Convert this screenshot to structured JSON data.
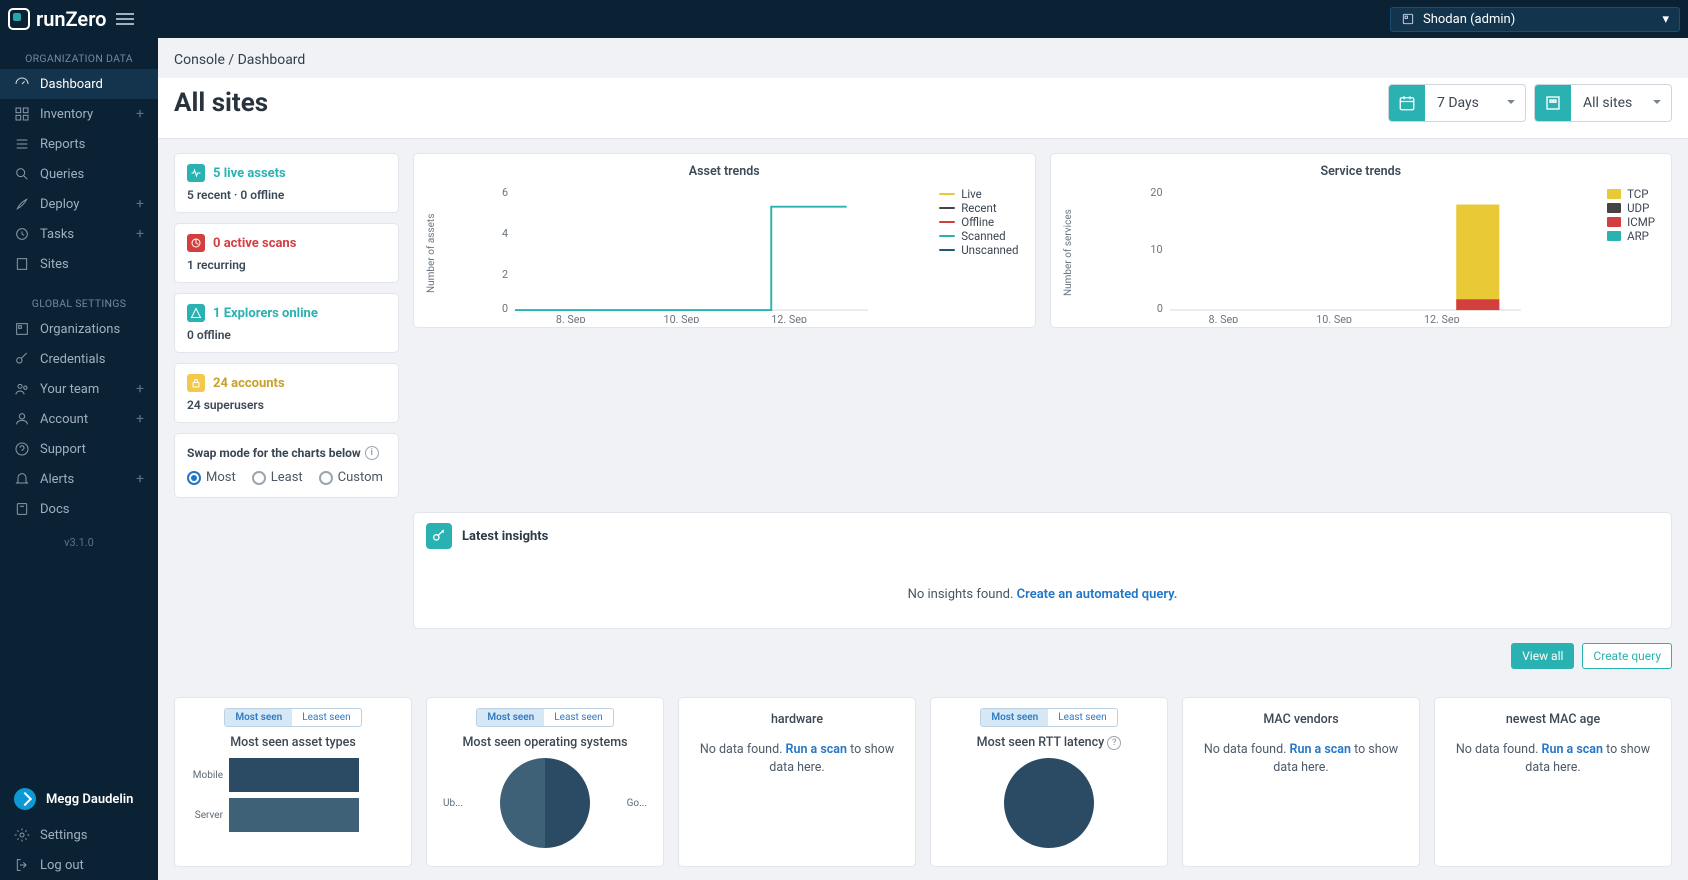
{
  "brand": "runZero",
  "org_selector": "Shodan (admin)",
  "sidebar": {
    "section1": "ORGANIZATION DATA",
    "section2": "GLOBAL SETTINGS",
    "items1": [
      {
        "label": "Dashboard",
        "plus": false,
        "active": true
      },
      {
        "label": "Inventory",
        "plus": true
      },
      {
        "label": "Reports",
        "plus": false
      },
      {
        "label": "Queries",
        "plus": false
      },
      {
        "label": "Deploy",
        "plus": true
      },
      {
        "label": "Tasks",
        "plus": true
      },
      {
        "label": "Sites",
        "plus": false
      }
    ],
    "items2": [
      {
        "label": "Organizations",
        "plus": false
      },
      {
        "label": "Credentials",
        "plus": false
      },
      {
        "label": "Your team",
        "plus": true
      },
      {
        "label": "Account",
        "plus": true
      },
      {
        "label": "Support",
        "plus": false
      },
      {
        "label": "Alerts",
        "plus": true
      },
      {
        "label": "Docs",
        "plus": false
      }
    ],
    "version": "v3.1.0",
    "user": "Megg Daudelin",
    "footer": [
      {
        "label": "Settings"
      },
      {
        "label": "Log out"
      }
    ]
  },
  "breadcrumb": {
    "root": "Console",
    "sep": "/",
    "leaf": "Dashboard"
  },
  "page_title": "All sites",
  "controls": {
    "range": "7 Days",
    "site": "All sites"
  },
  "stats": {
    "live": {
      "title": "5 live assets",
      "sub": "5 recent · 0 offline",
      "color": "#2ab1b1"
    },
    "scans": {
      "title": "0 active scans",
      "sub": "1 recurring",
      "title_color": "#d33f3f",
      "badge": "#d33f3f"
    },
    "explorers": {
      "title": "1 Explorers online",
      "sub": "0 offline",
      "color": "#2ab1b1"
    },
    "accounts": {
      "title": "24 accounts",
      "sub": "24 superusers",
      "badge": "#f3c94b",
      "title_color": "#c6a12c"
    }
  },
  "swap": {
    "title": "Swap mode for the charts below",
    "options": [
      "Most",
      "Least",
      "Custom"
    ],
    "selected": "Most"
  },
  "charts": {
    "assets": {
      "title": "Asset trends",
      "ylabel": "Number of assets",
      "legend": [
        "Live",
        "Recent",
        "Offline",
        "Scanned",
        "Unscanned"
      ],
      "legend_colors": [
        "#e9c936",
        "#444",
        "#d33f3f",
        "#2ab1b1",
        "#1a5b7a"
      ]
    },
    "services": {
      "title": "Service trends",
      "ylabel": "Number of services",
      "legend": [
        "TCP",
        "UDP",
        "ICMP",
        "ARP"
      ],
      "legend_colors": [
        "#e9c936",
        "#444",
        "#d33f3f",
        "#2ab1b1"
      ]
    }
  },
  "chart_data": [
    {
      "type": "line",
      "title": "Asset trends",
      "x": [
        "8. Sep",
        "10. Sep",
        "12. Sep"
      ],
      "ylim": [
        0,
        6
      ],
      "yticks": [
        0,
        2,
        4,
        6
      ],
      "series": [
        {
          "name": "Live",
          "color": "#e9c936",
          "values": [
            0,
            0,
            5
          ]
        },
        {
          "name": "Recent",
          "color": "#444",
          "values": [
            0,
            0,
            5
          ]
        },
        {
          "name": "Offline",
          "color": "#d33f3f",
          "values": [
            0,
            0,
            0
          ]
        },
        {
          "name": "Scanned",
          "color": "#2ab1b1",
          "values": [
            0,
            0,
            5
          ]
        },
        {
          "name": "Unscanned",
          "color": "#1a5b7a",
          "values": [
            0,
            0,
            0
          ]
        }
      ]
    },
    {
      "type": "area",
      "title": "Service trends",
      "x": [
        "8. Sep",
        "10. Sep",
        "12. Sep"
      ],
      "ylim": [
        0,
        20
      ],
      "yticks": [
        0,
        10,
        20
      ],
      "series": [
        {
          "name": "TCP",
          "color": "#e9c936",
          "values": [
            0,
            0,
            18
          ]
        },
        {
          "name": "UDP",
          "color": "#444",
          "values": [
            0,
            0,
            0
          ]
        },
        {
          "name": "ICMP",
          "color": "#d33f3f",
          "values": [
            0,
            0,
            2
          ]
        },
        {
          "name": "ARP",
          "color": "#2ab1b1",
          "values": [
            0,
            0,
            0
          ]
        }
      ]
    }
  ],
  "insights": {
    "title": "Latest insights",
    "none": "No insights found. ",
    "link": "Create an automated query."
  },
  "actions": {
    "view_all": "View all",
    "create": "Create query"
  },
  "bottom": {
    "most": "Most seen",
    "least": "Least seen",
    "p1_title": "Most seen asset types",
    "p1_row1": "Mobile",
    "p1_row2": "Server",
    "p2_title": "Most seen operating systems",
    "p2_l": "Ub...",
    "p2_r": "Go...",
    "p3_title": "hardware",
    "p4_title": "Most seen RTT latency",
    "p5_title": "MAC vendors",
    "p6_title": "newest MAC age",
    "nodata": "No data found. ",
    "run": "Run a scan",
    "nodata2": " to show data here."
  }
}
